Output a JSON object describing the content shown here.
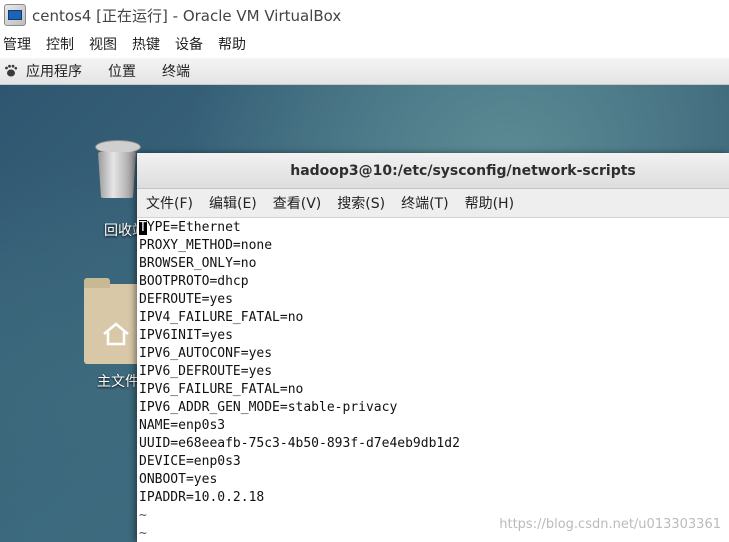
{
  "window": {
    "title": "centos4 [正在运行] - Oracle VM VirtualBox",
    "menu": [
      "管理",
      "控制",
      "视图",
      "热键",
      "设备",
      "帮助"
    ]
  },
  "guest_panel": {
    "items": [
      "应用程序",
      "位置",
      "终端"
    ]
  },
  "desktop": {
    "icons": [
      {
        "label": "回收站",
        "icon": "trash-icon"
      },
      {
        "label": "主文件夹",
        "icon": "home-folder-icon"
      }
    ]
  },
  "terminal": {
    "title": "hadoop3@10:/etc/sysconfig/network-scripts",
    "menu": [
      "文件(F)",
      "编辑(E)",
      "查看(V)",
      "搜索(S)",
      "终端(T)",
      "帮助(H)"
    ],
    "cursor_char": "T",
    "first_line_rest": "YPE=Ethernet",
    "lines": [
      "PROXY_METHOD=none",
      "BROWSER_ONLY=no",
      "BOOTPROTO=dhcp",
      "DEFROUTE=yes",
      "IPV4_FAILURE_FATAL=no",
      "IPV6INIT=yes",
      "IPV6_AUTOCONF=yes",
      "IPV6_DEFROUTE=yes",
      "IPV6_FAILURE_FATAL=no",
      "IPV6_ADDR_GEN_MODE=stable-privacy",
      "NAME=enp0s3",
      "UUID=e68eeafb-75c3-4b50-893f-d7e4eb9db1d2",
      "DEVICE=enp0s3",
      "ONBOOT=yes",
      "IPADDR=10.0.2.18"
    ],
    "empty_markers": [
      "~",
      "~"
    ]
  },
  "watermark": "https://blog.csdn.net/u013303361"
}
